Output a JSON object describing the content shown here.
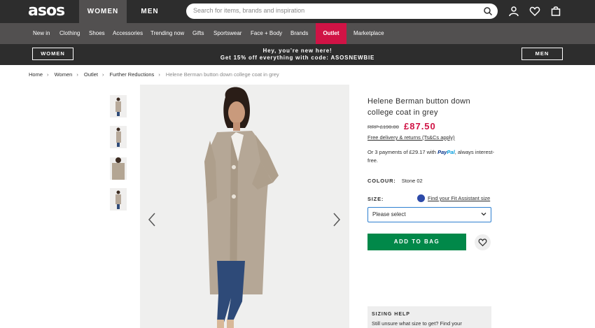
{
  "header": {
    "logo": "asos",
    "gender_tabs": [
      "WOMEN",
      "MEN"
    ],
    "search_placeholder": "Search for items, brands and inspiration",
    "icons": [
      "account-icon",
      "heart-icon",
      "bag-icon"
    ]
  },
  "nav": {
    "items": [
      "New in",
      "Clothing",
      "Shoes",
      "Accessories",
      "Trending now",
      "Gifts",
      "Sportswear",
      "Face + Body",
      "Brands",
      "Outlet",
      "Marketplace"
    ],
    "active": "Outlet",
    "active_color": "#d01345"
  },
  "promo": {
    "left_button": "WOMEN",
    "right_button": "MEN",
    "line1": "Hey, you’re new here!",
    "line2": "Get 15% off everything with code: ASOSNEWBIE"
  },
  "breadcrumb": [
    "Home",
    "Women",
    "Outlet",
    "Further Reductions",
    "Helene Berman button down college coat in grey"
  ],
  "product": {
    "title": "Helene Berman button down college coat in grey",
    "rrp": "RRP £190.00",
    "price": "£87.50",
    "price_color": "#d01345",
    "delivery": "Free delivery & returns (Ts&Cs apply)",
    "installments_prefix": "Or 3 payments of £29.17 with",
    "paypal_a": "Pay",
    "paypal_b": "Pal",
    "installments_suffix": ", always interest-free.",
    "colour_label": "COLOUR:",
    "colour_value": "Stone 02",
    "size_label": "SIZE:",
    "fit_assistant": "Find your Fit Assistant size",
    "size_select": "Please select",
    "add_to_bag": "ADD TO BAG",
    "add_color": "#018849"
  },
  "sizing_help": {
    "heading": "SIZING HELP",
    "text": "Still unsure what size to get? Find your"
  }
}
